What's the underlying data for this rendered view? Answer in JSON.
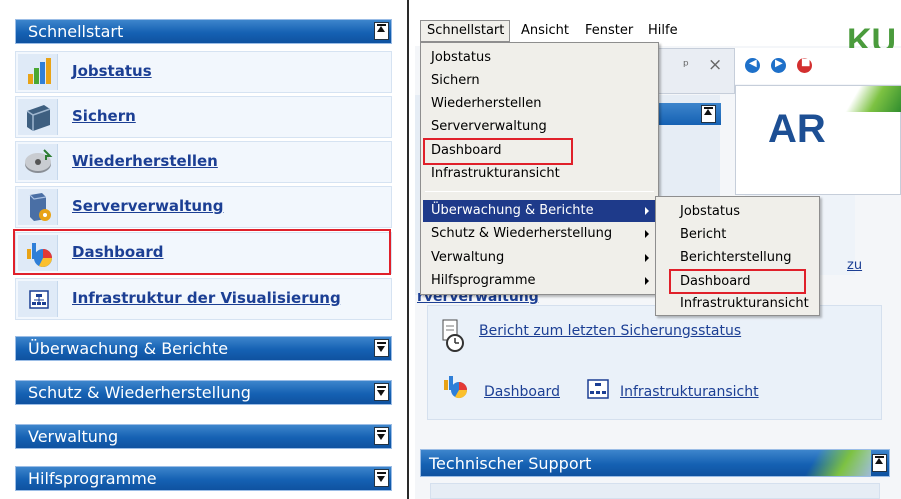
{
  "left_panel": {
    "header": "Schnellstart",
    "items": [
      {
        "label": "Jobstatus",
        "icon": "jobstatus-chart-icon"
      },
      {
        "label": "Sichern",
        "icon": "backup-icon"
      },
      {
        "label": "Wiederherstellen",
        "icon": "restore-icon"
      },
      {
        "label": "Serververwaltung",
        "icon": "server-management-icon"
      },
      {
        "label": "Dashboard",
        "icon": "dashboard-icon"
      },
      {
        "label": "Infrastruktur der Visualisierung",
        "icon": "infrastructure-icon"
      }
    ],
    "sections": [
      "Überwachung & Berichte",
      "Schutz & Wiederherstellung",
      "Verwaltung",
      "Hilfsprogramme"
    ]
  },
  "menubar": {
    "items": [
      "Schnellstart",
      "Ansicht",
      "Fenster",
      "Hilfe"
    ]
  },
  "schnellstart_menu": {
    "items": [
      "Jobstatus",
      "Sichern",
      "Wiederherstellen",
      "Serververwaltung",
      "Dashboard",
      "Infrastrukturansicht"
    ],
    "submenus": [
      "Überwachung & Berichte",
      "Schutz & Wiederherstellung",
      "Verwaltung",
      "Hilfsprogramme"
    ]
  },
  "monitoring_submenu": {
    "items": [
      "Jobstatus",
      "Bericht",
      "Berichterstellung",
      "Dashboard",
      "Infrastrukturansicht"
    ]
  },
  "background": {
    "partial_section_title": "rververwaltung",
    "report_link": "Bericht zum letzten Sicherungsstatus",
    "dashboard_link": "Dashboard",
    "infra_link": "Infrastrukturansicht",
    "support_header": "Technischer Support",
    "brand_partial": "KU",
    "logo_partial": "AR",
    "truncated_link": "zu",
    "pane_pin": "ᵖ",
    "pane_close": "×"
  },
  "colors": {
    "band_blue": "#1561b3",
    "link_blue": "#1c3f94",
    "highlight_red": "#e0202a",
    "menu_selection": "#1e3a8a"
  }
}
